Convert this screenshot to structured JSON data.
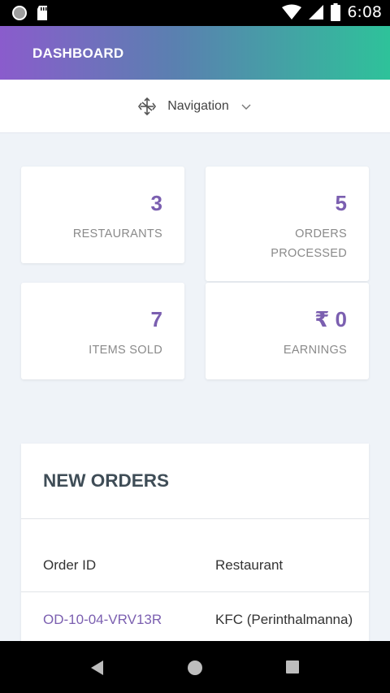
{
  "status_bar": {
    "time": "6:08"
  },
  "header": {
    "title": "DASHBOARD"
  },
  "navigation": {
    "label": "Navigation"
  },
  "stats": [
    {
      "value": "3",
      "label": "RESTAURANTS"
    },
    {
      "value": "5",
      "label": "ORDERS PROCESSED"
    },
    {
      "value": "7",
      "label": "ITEMS SOLD"
    },
    {
      "value": "₹ 0",
      "label": "EARNINGS"
    }
  ],
  "new_orders": {
    "title": "NEW ORDERS",
    "columns": [
      "Order ID",
      "Restaurant"
    ],
    "rows": [
      {
        "order_id": "OD-10-04-VRV13R",
        "restaurant": "KFC (Perinthalmanna)"
      }
    ]
  },
  "colors": {
    "accent": "#7b5fb0",
    "gradient_start": "#8a5ccc",
    "gradient_end": "#2ec29a"
  }
}
